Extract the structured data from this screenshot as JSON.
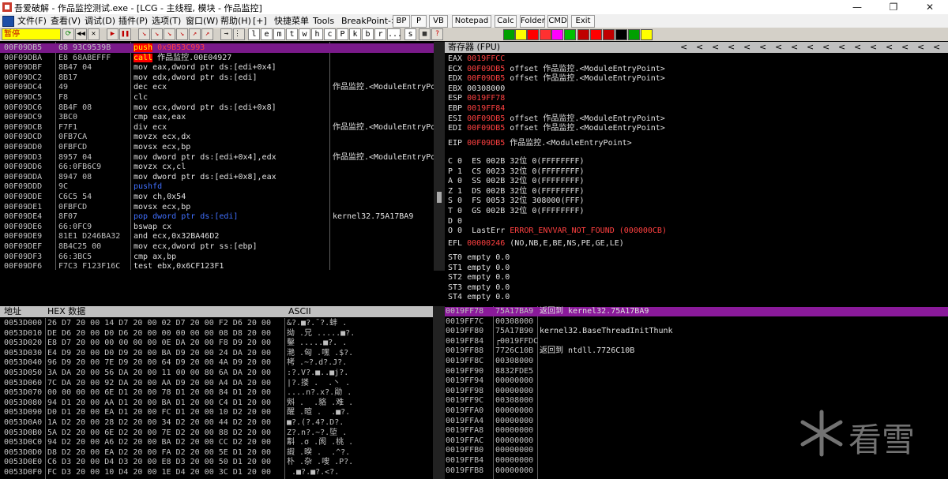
{
  "window": {
    "title": "吾爱破解 - 作品监控测试.exe - [LCG - 主线程, 模块 - 作品监控]",
    "controls": [
      "—",
      "❐",
      "✕"
    ]
  },
  "menu": {
    "items": [
      "文件(F)",
      "查看(V)",
      "调试(D)",
      "插件(P)",
      "选项(T)",
      "窗口(W)",
      "帮助(H)",
      "[+]",
      "快捷菜单",
      "Tools",
      "BreakPoint->"
    ],
    "buttons": [
      "BP",
      "P",
      "VB",
      "Notepad",
      "Calc",
      "Folder",
      "CMD",
      "Exit"
    ]
  },
  "toolbar": {
    "status": "暂停",
    "letters": [
      "l",
      "e",
      "m",
      "t",
      "w",
      "h",
      "c",
      "P",
      "k",
      "b",
      "r",
      "...",
      "s"
    ],
    "tool_glyphs": [
      "⟳",
      "◀◀",
      "✕",
      "▶",
      "❚❚",
      "↘",
      "↘",
      "↘",
      "↘",
      "↗",
      "↗",
      "→",
      "⋮⋮"
    ],
    "colors": [
      "#00a000",
      "#ffff00",
      "#ff0000",
      "#ff3030",
      "#ff00ff",
      "#00c000",
      "#c00000",
      "#ff0000",
      "#c00000",
      "#000000"
    ]
  },
  "disasm": {
    "rows": [
      {
        "addr": "00F09DB5",
        "hex": "68 93C9539B",
        "ins": "push 0x9B53C993",
        "cmt": "",
        "sel": true
      },
      {
        "addr": "00F09DBA",
        "hex": "E8 68ABEFFF",
        "ins": "call 作品监控.00E04927",
        "cmt": "",
        "call": true
      },
      {
        "addr": "00F09DBF",
        "hex": "8B47 04",
        "ins": "mov eax,dword ptr ds:[edi+0x4]",
        "cmt": ""
      },
      {
        "addr": "00F09DC2",
        "hex": "8B17",
        "ins": "mov edx,dword ptr ds:[edi]",
        "cmt": ""
      },
      {
        "addr": "00F09DC4",
        "hex": "49",
        "ins": "dec ecx",
        "cmt": "作品监控.<ModuleEntryPoint>"
      },
      {
        "addr": "00F09DC5",
        "hex": "F8",
        "ins": "clc",
        "cmt": ""
      },
      {
        "addr": "00F09DC6",
        "hex": "8B4F 08",
        "ins": "mov ecx,dword ptr ds:[edi+0x8]",
        "cmt": ""
      },
      {
        "addr": "00F09DC9",
        "hex": "3BC0",
        "ins": "cmp eax,eax",
        "cmt": ""
      },
      {
        "addr": "00F09DCB",
        "hex": "F7F1",
        "ins": "div ecx",
        "cmt": "作品监控.<ModuleEntryPoint>"
      },
      {
        "addr": "00F09DCD",
        "hex": "0FB7CA",
        "ins": "movzx ecx,dx",
        "cmt": ""
      },
      {
        "addr": "00F09DD0",
        "hex": "0FBFCD",
        "ins": "movsx ecx,bp",
        "cmt": ""
      },
      {
        "addr": "00F09DD3",
        "hex": "8957 04",
        "ins": "mov dword ptr ds:[edi+0x4],edx",
        "cmt": "作品监控.<ModuleEntryPoint>"
      },
      {
        "addr": "00F09DD6",
        "hex": "66:0FB6C9",
        "ins": "movzx cx,cl",
        "cmt": ""
      },
      {
        "addr": "00F09DDA",
        "hex": "8947 08",
        "ins": "mov dword ptr ds:[edi+0x8],eax",
        "cmt": ""
      },
      {
        "addr": "00F09DDD",
        "hex": "9C",
        "ins": "pushfd",
        "cmt": "",
        "blue": true
      },
      {
        "addr": "00F09DDE",
        "hex": "C6C5 54",
        "ins": "mov ch,0x54",
        "cmt": ""
      },
      {
        "addr": "00F09DE1",
        "hex": "0FBFCD",
        "ins": "movsx ecx,bp",
        "cmt": ""
      },
      {
        "addr": "00F09DE4",
        "hex": "8F07",
        "ins": "pop dword ptr ds:[edi]",
        "cmt": "kernel32.75A17BA9",
        "blue": true
      },
      {
        "addr": "00F09DE6",
        "hex": "66:0FC9",
        "ins": "bswap cx",
        "cmt": ""
      },
      {
        "addr": "00F09DE9",
        "hex": "81E1 D246BA32",
        "ins": "and ecx,0x32BA46D2",
        "cmt": ""
      },
      {
        "addr": "00F09DEF",
        "hex": "8B4C25 00",
        "ins": "mov ecx,dword ptr ss:[ebp]",
        "cmt": ""
      },
      {
        "addr": "00F09DF3",
        "hex": "66:3BC5",
        "ins": "cmp ax,bp",
        "cmt": ""
      },
      {
        "addr": "00F09DF6",
        "hex": "F7C3 F123F16C",
        "ins": "test ebx,0x6CF123F1",
        "cmt": ""
      }
    ]
  },
  "registers": {
    "header": "寄存器 (FPU)",
    "lines": [
      {
        "name": "EAX",
        "val": "0019FFCC",
        "rest": "",
        "red": true
      },
      {
        "name": "ECX",
        "val": "00F09DB5",
        "rest": "offset 作品监控.<ModuleEntryPoint>",
        "red": true
      },
      {
        "name": "EDX",
        "val": "00F09DB5",
        "rest": "offset 作品监控.<ModuleEntryPoint>",
        "red": true
      },
      {
        "name": "EBX",
        "val": "00308000",
        "rest": "",
        "red": false
      },
      {
        "name": "ESP",
        "val": "0019FF78",
        "rest": "",
        "red": true
      },
      {
        "name": "EBP",
        "val": "0019FF84",
        "rest": "",
        "red": true
      },
      {
        "name": "ESI",
        "val": "00F09DB5",
        "rest": "offset 作品监控.<ModuleEntryPoint>",
        "red": true
      },
      {
        "name": "EDI",
        "val": "00F09DB5",
        "rest": "offset 作品监控.<ModuleEntryPoint>",
        "red": true
      }
    ],
    "eip": {
      "name": "EIP",
      "val": "00F09DB5",
      "rest": "作品监控.<ModuleEntryPoint>"
    },
    "flags": [
      "C 0  ES 002B 32位 0(FFFFFFFF)",
      "P 1  CS 0023 32位 0(FFFFFFFF)",
      "A 0  SS 002B 32位 0(FFFFFFFF)",
      "Z 1  DS 002B 32位 0(FFFFFFFF)",
      "S 0  FS 0053 32位 308000(FFF)",
      "T 0  GS 002B 32位 0(FFFFFFFF)",
      "D 0",
      "O 0  LastErr "
    ],
    "lasterr": "ERROR_ENVVAR_NOT_FOUND (000000CB)",
    "efl_name": "EFL",
    "efl_val": "00000246",
    "efl_rest": "(NO,NB,E,BE,NS,PE,GE,LE)",
    "fpu": [
      "ST0 empty 0.0",
      "ST1 empty 0.0",
      "ST2 empty 0.0",
      "ST3 empty 0.0",
      "ST4 empty 0.0"
    ]
  },
  "dump": {
    "head_addr": "地址",
    "head_hex": "HEX 数据",
    "head_ascii": "ASCII",
    "rows": [
      {
        "a": "0053D000",
        "h": "26 D7 20 00|14 D7 20 00|02 D7 20 00|F2 D6 20 00",
        "s": "&?.■?.¯?.蚌 ."
      },
      {
        "a": "0053D010",
        "h": "DE D6 20 00|D0 D6 20 00|00 00 00 00|08 D8 20 00",
        "s": "拗 .兄 .....■?."
      },
      {
        "a": "0053D020",
        "h": "E8 D7 20 00|00 00 00 00|0E DA 20 00|F8 D9 20 00",
        "s": "鑿 .....■?. ."
      },
      {
        "a": "0053D030",
        "h": "E4 D9 20 00|D0 D9 20 00|BA D9 20 00|24 DA 20 00",
        "s": "滟 .匈 .嘿 .$?."
      },
      {
        "a": "0053D040",
        "h": "96 D9 20 00|7E D9 20 00|64 D9 20 00|4A D9 20 00",
        "s": "栲 .~?.d?.J?."
      },
      {
        "a": "0053D050",
        "h": "3A DA 20 00|56 DA 20 00|11 00 00 80|6A DA 20 00",
        "s": ":?.V?.■..■j?."
      },
      {
        "a": "0053D060",
        "h": "7C DA 20 00|92 DA 20 00|AA D9 20 00|A4 DA 20 00",
        "s": "|?.搂 .  .丶 ."
      },
      {
        "a": "0053D070",
        "h": "00 00 00 00|6E D1 20 00|78 D1 20 00|84 D1 20 00",
        "s": "....n?.x?.勛 ."
      },
      {
        "a": "0053D080",
        "h": "94 D1 20 00|AA D1 20 00|BA D1 20 00|C4 D1 20 00",
        "s": "斞 .  .貉 .难 ."
      },
      {
        "a": "0053D090",
        "h": "D0 D1 20 00|EA D1 20 00|FC D1 20 00|10 D2 20 00",
        "s": "醒 .暄 .  .■?."
      },
      {
        "a": "0053D0A0",
        "h": "1A D2 20 00|28 D2 20 00|34 D2 20 00|44 D2 20 00",
        "s": "■?.(?.4?.D?."
      },
      {
        "a": "0053D0B0",
        "h": "5A D2 20 00|6E D2 20 00|7E D2 20 00|88 D2 20 00",
        "s": "Z?.n?.~?.埅 ."
      },
      {
        "a": "0053D0C0",
        "h": "94 D2 20 00|A6 D2 20 00|BA D2 20 00|CC D2 20 00",
        "s": "斠 .σ .阂 .桃 ."
      },
      {
        "a": "0053D0D0",
        "h": "D8 D2 20 00|EA D2 20 00|FA D2 20 00|5E D1 20 00",
        "s": "嘏 .暌 .  .^?."
      },
      {
        "a": "0053D0E0",
        "h": "C6 D3 20 00|D4 D3 20 00|E8 D3 20 00|50 D1 20 00",
        "s": "朴 .杂 .嗖 .P?."
      },
      {
        "a": "0053D0F0",
        "h": "FC D3 20 00|10 D4 20 00|1E D4 20 00|3C D1 20 00",
        "s": " .■?.■?.<?."
      }
    ]
  },
  "stack": {
    "rows": [
      {
        "a": "0019FF78",
        "v": "75A17BA9",
        "c": "返回到 kernel32.75A17BA9",
        "top": true
      },
      {
        "a": "0019FF7C",
        "v": "00308000",
        "c": ""
      },
      {
        "a": "0019FF80",
        "v": "75A17B90",
        "c": "kernel32.BaseThreadInitThunk"
      },
      {
        "a": "0019FF84",
        "v": "┌0019FFDC",
        "c": ""
      },
      {
        "a": "0019FF88",
        "v": "7726C10B",
        "c": "返回到 ntdll.7726C10B"
      },
      {
        "a": "0019FF8C",
        "v": "00308000",
        "c": ""
      },
      {
        "a": "0019FF90",
        "v": "8832FDE5",
        "c": ""
      },
      {
        "a": "0019FF94",
        "v": "00000000",
        "c": ""
      },
      {
        "a": "0019FF98",
        "v": "00000000",
        "c": ""
      },
      {
        "a": "0019FF9C",
        "v": "00308000",
        "c": ""
      },
      {
        "a": "0019FFA0",
        "v": "00000000",
        "c": ""
      },
      {
        "a": "0019FFA4",
        "v": "00000000",
        "c": ""
      },
      {
        "a": "0019FFA8",
        "v": "00000000",
        "c": ""
      },
      {
        "a": "0019FFAC",
        "v": "00000000",
        "c": ""
      },
      {
        "a": "0019FFB0",
        "v": "00000000",
        "c": ""
      },
      {
        "a": "0019FFB4",
        "v": "00000000",
        "c": ""
      },
      {
        "a": "0019FFB8",
        "v": "00000000",
        "c": ""
      }
    ]
  },
  "watermark": {
    "text": "看雪"
  },
  "icons": [
    "app-icon",
    "minimize-icon",
    "maximize-icon",
    "close-icon",
    "snowflake-logo-icon"
  ]
}
